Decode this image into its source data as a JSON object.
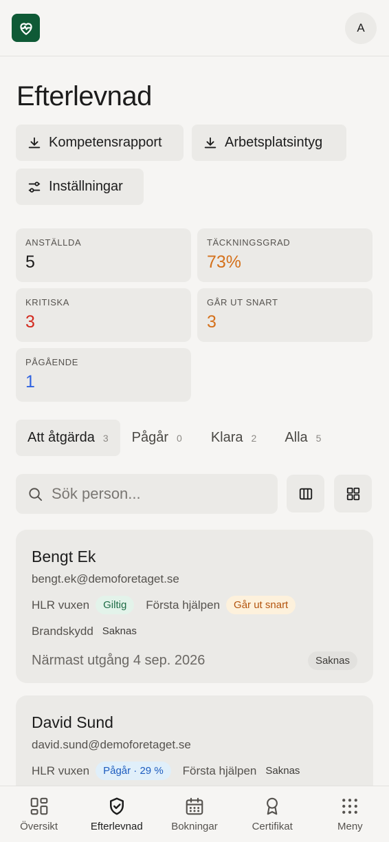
{
  "header": {
    "avatar_initial": "A"
  },
  "page": {
    "title": "Efterlevnad"
  },
  "actions": {
    "competence_report": "Kompetensrapport",
    "workplace_cert": "Arbetsplatsintyg",
    "settings": "Inställningar"
  },
  "stats": {
    "employees": {
      "label": "ANSTÄLLDA",
      "value": "5"
    },
    "coverage": {
      "label": "TÄCKNINGSGRAD",
      "value": "73%",
      "color": "#d4711c"
    },
    "critical": {
      "label": "KRITISKA",
      "value": "3",
      "color": "#d32a1f"
    },
    "expiring": {
      "label": "GÅR UT SNART",
      "value": "3",
      "color": "#d4711c"
    },
    "ongoing": {
      "label": "PÅGÅENDE",
      "value": "1",
      "color": "#2f62e0"
    }
  },
  "tabs": [
    {
      "label": "Att åtgärda",
      "count": "3"
    },
    {
      "label": "Pågår",
      "count": "0"
    },
    {
      "label": "Klara",
      "count": "2"
    },
    {
      "label": "Alla",
      "count": "5"
    }
  ],
  "search": {
    "placeholder": "Sök person..."
  },
  "people": [
    {
      "name": "Bengt Ek",
      "email": "bengt.ek@demoforetaget.se",
      "courses": [
        {
          "name": "HLR vuxen",
          "status": "Giltig"
        },
        {
          "name": "Första hjälpen",
          "status": "Går ut snart"
        },
        {
          "name": "Brandskydd",
          "status": "Saknas"
        }
      ],
      "nearest": "Närmast utgång 4 sep. 2026",
      "overall": "Saknas"
    },
    {
      "name": "David Sund",
      "email": "david.sund@demoforetaget.se",
      "courses": [
        {
          "name": "HLR vuxen",
          "status": "Pågår · 29 %"
        },
        {
          "name": "Första hjälpen",
          "status": "Saknas"
        }
      ]
    }
  ],
  "nav": [
    {
      "label": "Översikt",
      "icon": "grid-icon"
    },
    {
      "label": "Efterlevnad",
      "icon": "shield-check-icon"
    },
    {
      "label": "Bokningar",
      "icon": "calendar-icon"
    },
    {
      "label": "Certifikat",
      "icon": "award-icon"
    },
    {
      "label": "Meny",
      "icon": "dots-grid-icon"
    }
  ],
  "colors": {
    "brand": "#0f5a36",
    "background": "#f6f5f3",
    "surface": "#ebeae7"
  }
}
